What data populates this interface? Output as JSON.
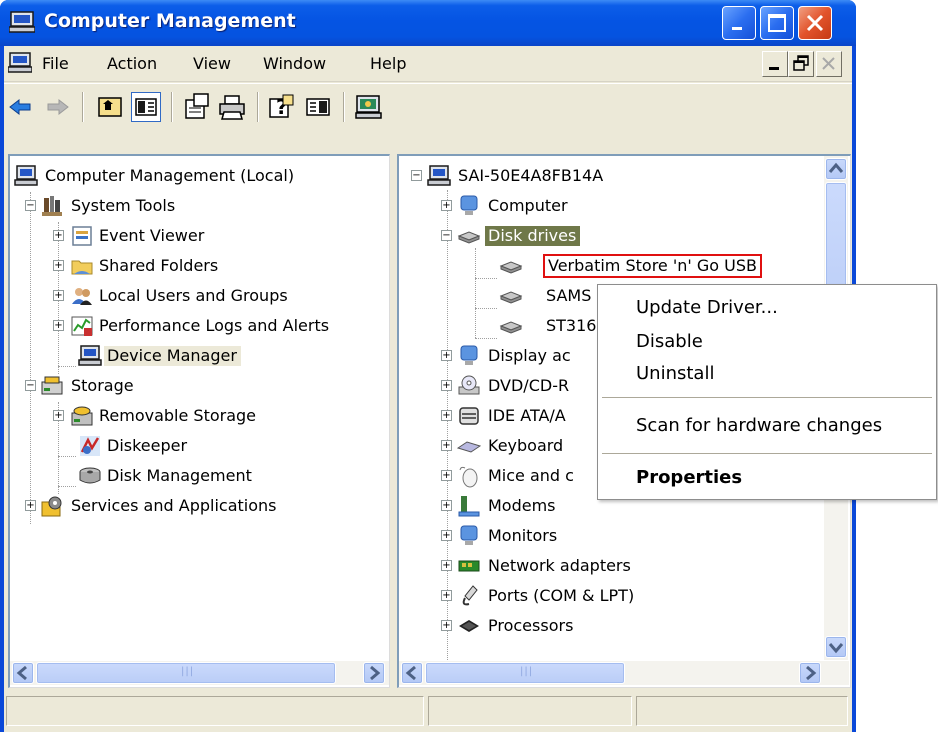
{
  "window": {
    "title": "Computer Management",
    "icon": "computer-management-icon"
  },
  "menu": {
    "items": [
      "File",
      "Action",
      "View",
      "Window",
      "Help"
    ]
  },
  "toolbar": {
    "buttons": [
      "back-icon",
      "forward-icon",
      "up-level-icon",
      "show-hide-tree-icon",
      "properties-icon",
      "print-icon",
      "help-icon",
      "show-hide-action-pane-icon",
      "device-manager-icon"
    ]
  },
  "left_tree": {
    "root": "Computer Management (Local)",
    "system_tools": "System Tools",
    "event_viewer": "Event Viewer",
    "shared_folders": "Shared Folders",
    "local_users": "Local Users and Groups",
    "perf_logs": "Performance Logs and Alerts",
    "device_manager": "Device Manager",
    "storage": "Storage",
    "removable_storage": "Removable Storage",
    "diskeeper": "Diskeeper",
    "disk_management": "Disk Management",
    "services": "Services and Applications"
  },
  "right_tree": {
    "root": "SAI-50E4A8FB14A",
    "computer": "Computer",
    "disk_drives": "Disk drives",
    "verbatim": "Verbatim Store 'n' Go USB",
    "samsung": "SAMS",
    "st316": "ST316",
    "display": "Display ac",
    "dvd": "DVD/CD-R",
    "ide": "IDE ATA/A",
    "keyboards": "Keyboard",
    "mice": "Mice and c",
    "modems": "Modems",
    "monitors": "Monitors",
    "network": "Network adapters",
    "ports": "Ports (COM & LPT)",
    "processors": "Processors"
  },
  "context_menu": {
    "update_driver": "Update Driver...",
    "disable": "Disable",
    "uninstall": "Uninstall",
    "scan": "Scan for hardware changes",
    "properties": "Properties"
  },
  "colors": {
    "titlebar": "#0554e3",
    "close_button": "#e2542c",
    "selection_green": "#6f7849",
    "highlight_red": "#e01010",
    "face": "#ece9d8"
  }
}
